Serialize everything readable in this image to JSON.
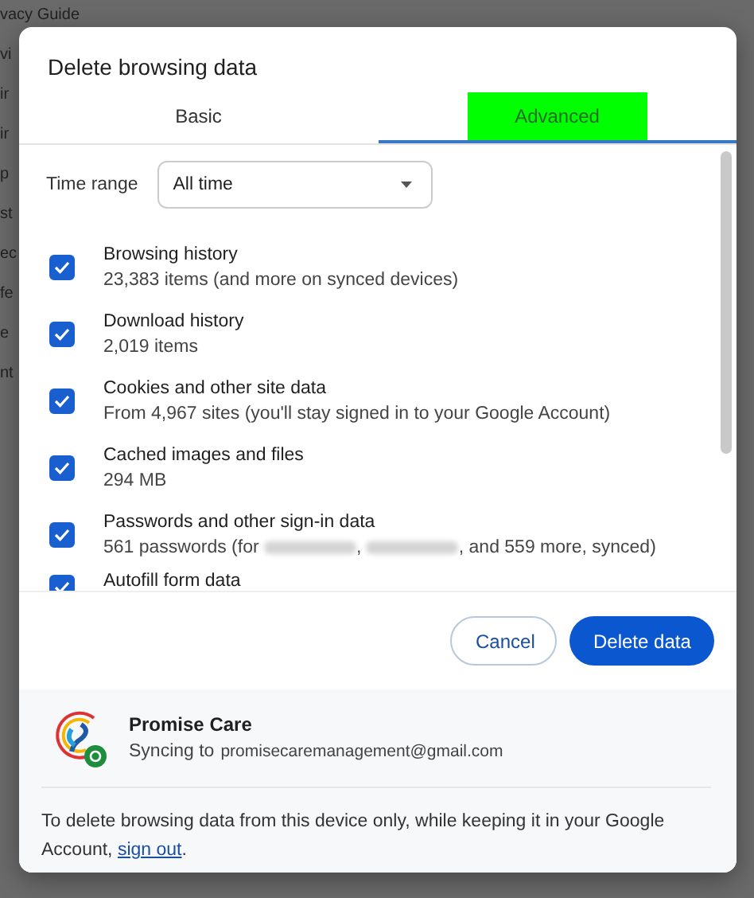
{
  "background_fragments": [
    "vacy Guide",
    "vi",
    "ir",
    "ir",
    "p",
    "st",
    "ec",
    "fe",
    "e",
    "nt"
  ],
  "dialog": {
    "title": "Delete browsing data",
    "tabs": [
      {
        "label": "Basic",
        "selected": false
      },
      {
        "label": "Advanced",
        "selected": true
      }
    ],
    "time_range": {
      "label": "Time range",
      "value": "All time"
    },
    "items": [
      {
        "title": "Browsing history",
        "description": "23,383 items (and more on synced devices)",
        "checked": true
      },
      {
        "title": "Download history",
        "description": "2,019 items",
        "checked": true
      },
      {
        "title": "Cookies and other site data",
        "description": "From 4,967 sites (you'll stay signed in to your Google Account)",
        "checked": true
      },
      {
        "title": "Cached images and files",
        "description": "294 MB",
        "checked": true
      },
      {
        "title": "Passwords and other sign-in data",
        "description_parts": [
          "561 passwords (for ",
          ", ",
          ", and 559 more, synced)"
        ],
        "checked": true
      },
      {
        "title": "Autofill form data",
        "checked": true
      }
    ],
    "buttons": [
      {
        "label": "Cancel",
        "kind": "secondary"
      },
      {
        "label": "Delete data",
        "kind": "primary"
      }
    ],
    "account": {
      "name": "Promise Care",
      "sync_label": "Syncing to",
      "email": "promisecaremanagement@gmail.com"
    },
    "footer_text": "To delete browsing data from this device only, while keeping it in your Google Account, ",
    "footer_link": "sign out",
    "footer_end": "."
  }
}
